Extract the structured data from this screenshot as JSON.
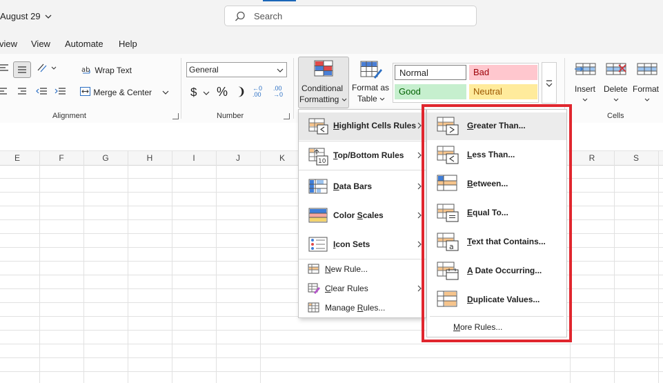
{
  "titlebar": {
    "doc_title": "August 29",
    "search_placeholder": "Search"
  },
  "tabs": [
    "view",
    "View",
    "Automate",
    "Help"
  ],
  "ribbon": {
    "alignment": {
      "wrap_text": "Wrap Text",
      "merge_center": "Merge & Center",
      "label": "Alignment"
    },
    "number": {
      "format_value": "General",
      "currency": "$",
      "percent": "%",
      "comma": "❩",
      "label": "Number",
      "inc_decimal": "←0 .00",
      "dec_decimal": ".00 →0"
    },
    "conditional_formatting": {
      "line1": "Conditional",
      "line2": "Formatting"
    },
    "format_as_table": {
      "line1": "Format as",
      "line2": "Table"
    },
    "styles": {
      "normal": "Normal",
      "bad": "Bad",
      "good": "Good",
      "neutral": "Neutral"
    },
    "cells": {
      "insert": "Insert",
      "delete": "Delete",
      "format": "Format",
      "label": "Cells"
    }
  },
  "columns": [
    "E",
    "F",
    "G",
    "H",
    "I",
    "J",
    "K",
    "R",
    "S"
  ],
  "cf_menu": {
    "items": [
      {
        "pre": "",
        "u": "H",
        "post": "ighlight Cells Rules"
      },
      {
        "pre": "",
        "u": "T",
        "post": "op/Bottom Rules"
      },
      {
        "pre": "",
        "u": "D",
        "post": "ata Bars"
      },
      {
        "pre": "Color ",
        "u": "S",
        "post": "cales"
      },
      {
        "pre": "",
        "u": "I",
        "post": "con Sets"
      }
    ],
    "small_items": [
      {
        "pre": "",
        "u": "N",
        "post": "ew Rule..."
      },
      {
        "pre": "",
        "u": "C",
        "post": "lear Rules"
      },
      {
        "pre": "Manage ",
        "u": "R",
        "post": "ules..."
      }
    ]
  },
  "sub_menu": {
    "items": [
      {
        "pre": "",
        "u": "G",
        "post": "reater Than..."
      },
      {
        "pre": "",
        "u": "L",
        "post": "ess Than..."
      },
      {
        "pre": "",
        "u": "B",
        "post": "etween..."
      },
      {
        "pre": "",
        "u": "E",
        "post": "qual To..."
      },
      {
        "pre": "",
        "u": "T",
        "post": "ext that Contains..."
      },
      {
        "pre": "",
        "u": "A",
        "post": " Date Occurring..."
      },
      {
        "pre": "",
        "u": "D",
        "post": "uplicate Values..."
      }
    ],
    "more": {
      "pre": "",
      "u": "M",
      "post": "ore Rules..."
    }
  },
  "colors": {
    "accent": "#1a66b8",
    "highlight_box": "#e0262e",
    "bad_bg": "#ffc7ce",
    "bad_fg": "#9c0006",
    "good_bg": "#c6efce",
    "good_fg": "#006100",
    "neutral_bg": "#ffeb9c",
    "neutral_fg": "#9c5700"
  }
}
